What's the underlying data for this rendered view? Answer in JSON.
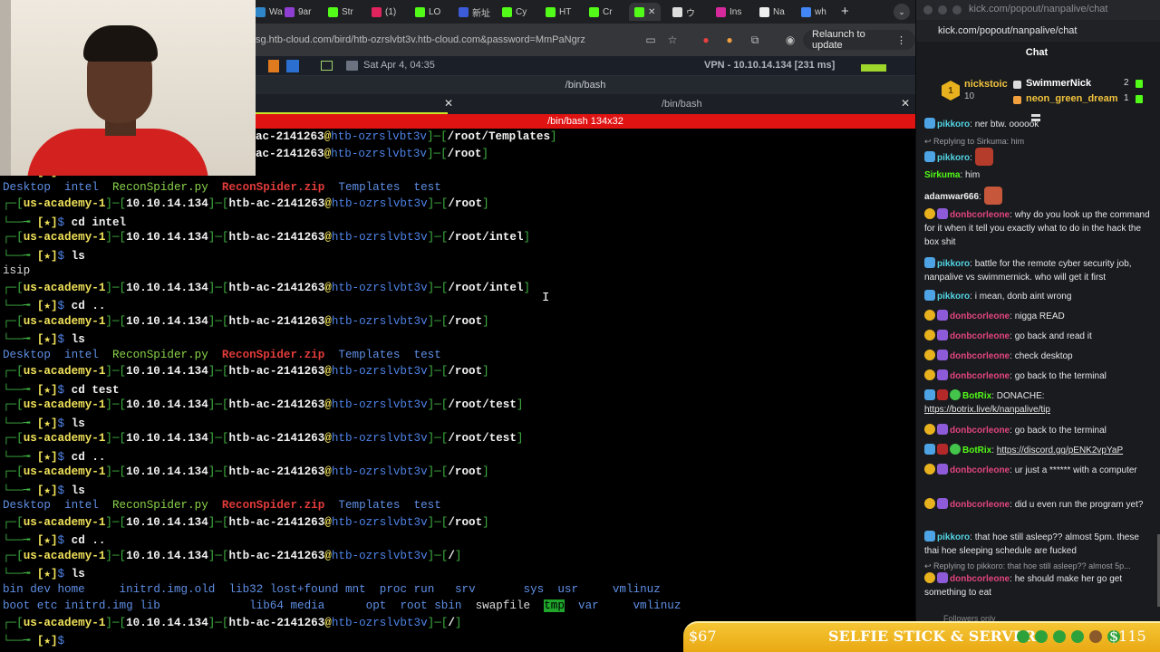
{
  "browser": {
    "tabs": [
      {
        "label": "Wa",
        "color": "#2f86c9"
      },
      {
        "label": "9ar",
        "color": "#8e3fd1"
      },
      {
        "label": "Str",
        "color": "#53fc18"
      },
      {
        "label": "(1)",
        "color": "#e0245e"
      },
      {
        "label": "LO",
        "color": "#53fc18"
      },
      {
        "label": "新址",
        "color": "#3b5bd9"
      },
      {
        "label": "Cy",
        "color": "#53fc18"
      },
      {
        "label": "HT",
        "color": "#53fc18"
      },
      {
        "label": "Cr",
        "color": "#53fc18"
      },
      {
        "label": "",
        "color": "#53fc18"
      },
      {
        "label": "ウ",
        "color": "#dddddd"
      },
      {
        "label": "Ins",
        "color": "#d6299b"
      },
      {
        "label": "Na",
        "color": "#eeeeee"
      },
      {
        "label": "wh",
        "color": "#4285f4"
      }
    ],
    "new_tab": "+",
    "tab_menu": "⌄",
    "url": "sg.htb-cloud.com/bird/htb-ozrslvbt3v.htb-cloud.com&password=MmPaNgrz",
    "relaunch_label": "Relaunch to update",
    "relaunch_more": "⋮"
  },
  "vm": {
    "date": "Sat Apr 4, 04:35",
    "vpn": "VPN - 10.10.14.134 [231 ms]",
    "term_title": "/bin/bash",
    "tab2_label": "/bin/bash",
    "size_label": "/bin/bash 134x32",
    "close_glyph": "✕"
  },
  "terminal": {
    "prompt": {
      "host": "us-academy-1",
      "ip": "10.10.14.134",
      "user": "htb-ac-2141263",
      "machine": "htb-ozrslvbt3v"
    },
    "lines": [
      {
        "kind": "tail",
        "text": "ac-2141263",
        "machine": "htb-ozrslvbt3v",
        "path": "/root/Templates"
      },
      {
        "kind": "tail",
        "text": "ac-2141263",
        "machine": "htb-ozrslvbt3v",
        "path": "/root"
      },
      {
        "kind": "cmd",
        "cmd": "ls"
      },
      {
        "kind": "ls1"
      },
      {
        "kind": "prompt",
        "path": "/root"
      },
      {
        "kind": "cmd",
        "cmd": "cd intel"
      },
      {
        "kind": "prompt",
        "path": "/root/intel"
      },
      {
        "kind": "cmd",
        "cmd": "ls"
      },
      {
        "kind": "plain",
        "text": "isip"
      },
      {
        "kind": "prompt",
        "path": "/root/intel"
      },
      {
        "kind": "cmd",
        "cmd": "cd .."
      },
      {
        "kind": "prompt",
        "path": "/root"
      },
      {
        "kind": "cmd",
        "cmd": "ls"
      },
      {
        "kind": "ls1"
      },
      {
        "kind": "prompt",
        "path": "/root"
      },
      {
        "kind": "cmd",
        "cmd": "cd test"
      },
      {
        "kind": "prompt",
        "path": "/root/test"
      },
      {
        "kind": "cmd",
        "cmd": "ls"
      },
      {
        "kind": "prompt",
        "path": "/root/test"
      },
      {
        "kind": "cmd",
        "cmd": "cd .."
      },
      {
        "kind": "prompt",
        "path": "/root"
      },
      {
        "kind": "cmd",
        "cmd": "ls"
      },
      {
        "kind": "ls1"
      },
      {
        "kind": "prompt",
        "path": "/root"
      },
      {
        "kind": "cmd",
        "cmd": "cd .."
      },
      {
        "kind": "prompt",
        "path": "/"
      },
      {
        "kind": "cmd",
        "cmd": "ls"
      },
      {
        "kind": "lsroot1"
      },
      {
        "kind": "lsroot2"
      },
      {
        "kind": "prompt",
        "path": "/"
      }
    ],
    "root_ls": {
      "desktop": "Desktop",
      "intel": "intel",
      "recon_py": "ReconSpider.py",
      "recon_zip": "ReconSpider.zip",
      "templates": "Templates",
      "test": "test"
    },
    "slash_ls_row1": [
      {
        "t": "bin",
        "c": "c"
      },
      {
        "t": "dev",
        "c": "c"
      },
      {
        "t": "home",
        "c": "c"
      },
      {
        "t": "initrd.img.old",
        "c": "c"
      },
      {
        "t": "lib32",
        "c": "c"
      },
      {
        "t": "lost+found",
        "c": "c"
      },
      {
        "t": "mnt",
        "c": "c"
      },
      {
        "t": "proc",
        "c": "c"
      },
      {
        "t": "run",
        "c": "c"
      },
      {
        "t": "srv",
        "c": "c"
      },
      {
        "t": "sys",
        "c": "c"
      },
      {
        "t": "usr",
        "c": "c"
      },
      {
        "t": "vmlinuz",
        "c": "c"
      }
    ],
    "slash_ls_row2": [
      {
        "t": "boot",
        "c": "c"
      },
      {
        "t": "etc",
        "c": "c"
      },
      {
        "t": "initrd.img",
        "c": "c"
      },
      {
        "t": "lib",
        "c": "c"
      },
      {
        "t": "lib64",
        "c": "c"
      },
      {
        "t": "media",
        "c": "c"
      },
      {
        "t": "opt",
        "c": "c"
      },
      {
        "t": "root",
        "c": "c"
      },
      {
        "t": "sbin",
        "c": "c"
      },
      {
        "t": "swapfile",
        "c": "plain"
      },
      {
        "t": "tmp",
        "c": "hl"
      },
      {
        "t": "var",
        "c": "c"
      },
      {
        "t": "vmlinuz",
        "c": "c"
      }
    ]
  },
  "kick": {
    "window_title": "kick.com/popout/nanpalive/chat",
    "url": "kick.com/popout/nanpalive/chat",
    "chat_title": "Chat",
    "top_gifter": {
      "rank": "1",
      "name": "nickstoic",
      "count": "10"
    },
    "top_list": [
      {
        "name": "SwimmerNick",
        "count": "2"
      },
      {
        "name": "neon_green_dream",
        "count": "1"
      }
    ],
    "messages": [
      {
        "user": "pikkoro",
        "cls": "n-pik",
        "text": "ner btw. oooook",
        "badges": [
          "b-blue"
        ]
      },
      {
        "reply": "Replying to Sirkuma: him"
      },
      {
        "user": "pikkoro",
        "cls": "n-pik",
        "text": "",
        "badges": [
          "b-blue"
        ],
        "emote": "#b53b2b"
      },
      {
        "user": "Sirkuma",
        "cls": "n-sir",
        "text": "him",
        "badges": []
      },
      {
        "user": "adamwar666",
        "cls": "n-adam",
        "text": "",
        "badges": [],
        "emote": "#c7573a"
      },
      {
        "user": "donbcorleone",
        "cls": "n-donb",
        "text": "why do you look up the command for it when it tell you exactly what to do in the hack the box shit",
        "badges": [
          "b-gold",
          "b-purple"
        ]
      },
      {
        "user": "pikkoro",
        "cls": "n-pik",
        "text": "battle for the remote cyber security job, nanpalive vs swimmernick. who will get it first",
        "badges": [
          "b-blue"
        ]
      },
      {
        "user": "pikkoro",
        "cls": "n-pik",
        "text": "i mean, donb aint wrong",
        "badges": [
          "b-blue"
        ]
      },
      {
        "user": "donbcorleone",
        "cls": "n-donb",
        "text": "nigga READ",
        "badges": [
          "b-gold",
          "b-purple"
        ]
      },
      {
        "user": "donbcorleone",
        "cls": "n-donb",
        "text": "go back and read it",
        "badges": [
          "b-gold",
          "b-purple"
        ]
      },
      {
        "user": "donbcorleone",
        "cls": "n-donb",
        "text": "check desktop",
        "badges": [
          "b-gold",
          "b-purple"
        ]
      },
      {
        "user": "donbcorleone",
        "cls": "n-donb",
        "text": "go back to the terminal",
        "badges": [
          "b-gold",
          "b-purple"
        ]
      },
      {
        "user": "BotRix",
        "cls": "n-bot",
        "text": "DONACHE: ",
        "link": "https://botrix.live/k/nanpalive/tip",
        "badges": [
          "b-blue",
          "b-red",
          "b-green"
        ]
      },
      {
        "user": "donbcorleone",
        "cls": "n-donb",
        "text": "go back to the terminal",
        "badges": [
          "b-gold",
          "b-purple"
        ]
      },
      {
        "user": "BotRix",
        "cls": "n-bot",
        "text": "",
        "link": "https://discord.gg/pENK2vpYaP",
        "badges": [
          "b-blue",
          "b-red",
          "b-green"
        ]
      },
      {
        "user": "donbcorleone",
        "cls": "n-donb",
        "text": "ur just a ****** with a computer",
        "badges": [
          "b-gold",
          "b-purple"
        ]
      },
      {
        "user": "donbcorleone",
        "cls": "n-donb",
        "text": "did u even run the program yet?",
        "badges": [
          "b-gold",
          "b-purple"
        ]
      },
      {
        "user": "pikkoro",
        "cls": "n-pik",
        "text": "that hoe still asleep?? almost 5pm. these thai hoe sleeping schedule are fucked",
        "badges": [
          "b-blue"
        ]
      },
      {
        "reply": "Replying to pikkoro: that hoe still asleep?? almost 5p..."
      },
      {
        "user": "donbcorleone",
        "cls": "n-donb",
        "text": "he should make her go get something to eat",
        "badges": [
          "b-gold",
          "b-purple"
        ]
      }
    ],
    "followers_only": "Followers only"
  },
  "ticker": {
    "amount_left": "$67",
    "text": "SELFIE STICK & SERVER",
    "amount_right": "$115",
    "emote_colors": [
      "#2ea23a",
      "#2ea23a",
      "#2ea23a",
      "#2ea23a",
      "#8a5a2a",
      "#2ea23a"
    ]
  }
}
